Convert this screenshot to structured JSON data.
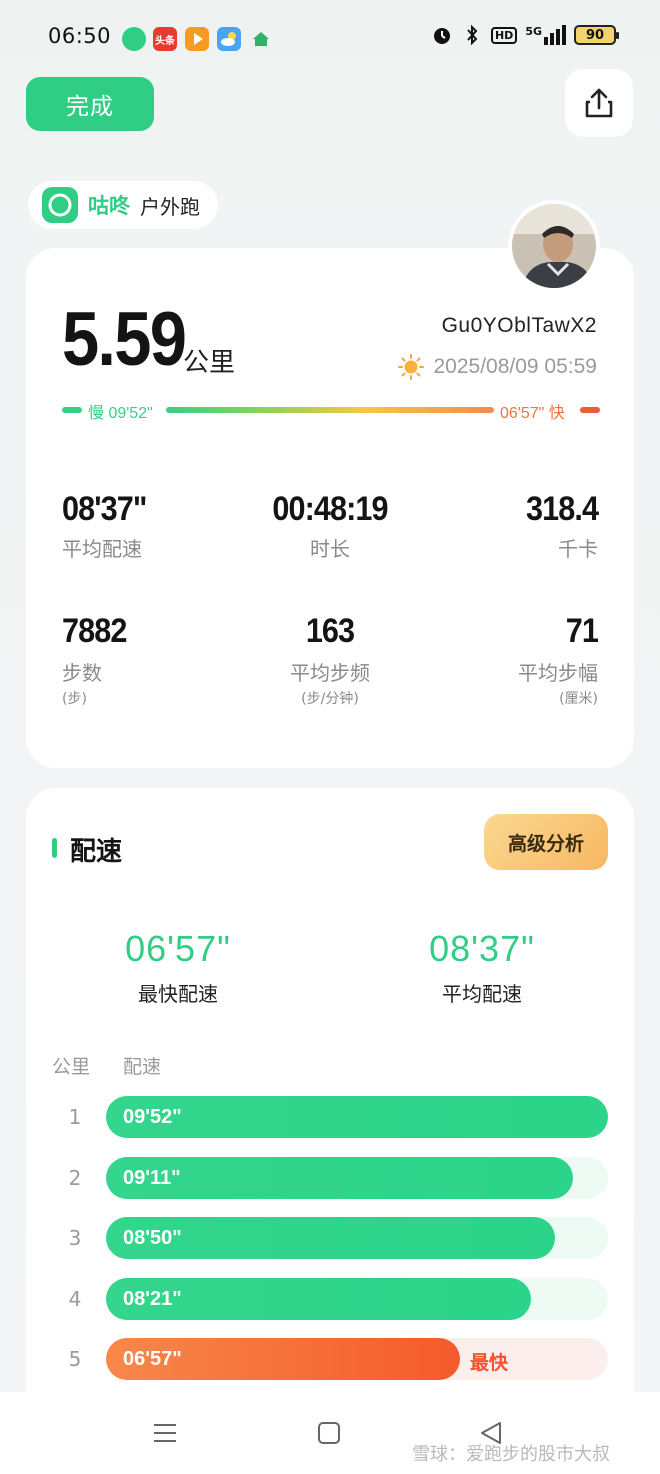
{
  "status_bar": {
    "time": "06:50",
    "app_icons": [
      "dongdong-icon",
      "toutiao-icon",
      "video-icon",
      "weather-icon",
      "anjuke-icon"
    ],
    "right_icons": [
      "alarm-icon",
      "bluetooth-icon",
      "hd-icon",
      "signal-5g-icon"
    ],
    "hd": "HD",
    "net": "5G",
    "battery": "90"
  },
  "header": {
    "done_label": "完成"
  },
  "brand": {
    "name": "咕咚",
    "activity": "户外跑"
  },
  "summary": {
    "distance": "5.59",
    "distance_unit": "公里",
    "username": "Gu0YOblTawX2",
    "datetime": "2025/08/09 05:59",
    "pace_slow": "慢 09'52\"",
    "pace_fast": "06'57\" 快",
    "stats": [
      {
        "value": "08'37\"",
        "label": "平均配速"
      },
      {
        "value": "00:48:19",
        "label": "时长"
      },
      {
        "value": "318.4",
        "label": "千卡"
      },
      {
        "value": "7882",
        "label": "步数",
        "sub": "(步)"
      },
      {
        "value": "163",
        "label": "平均步频",
        "sub": "(步/分钟)"
      },
      {
        "value": "71",
        "label": "平均步幅",
        "sub": "(厘米)"
      }
    ]
  },
  "pace_section": {
    "title": "配速",
    "advanced_label": "高级分析",
    "fastest_value": "06'57\"",
    "fastest_label": "最快配速",
    "average_value": "08'37\"",
    "average_label": "平均配速",
    "col_km": "公里",
    "col_pace": "配速",
    "fastest_tag": "最快",
    "splits": [
      {
        "km": "1",
        "pace": "09'52\"",
        "fill_pct": 100,
        "fastest": false
      },
      {
        "km": "2",
        "pace": "09'11\"",
        "fill_pct": 93,
        "fastest": false
      },
      {
        "km": "3",
        "pace": "08'50\"",
        "fill_pct": 89.5,
        "fastest": false
      },
      {
        "km": "4",
        "pace": "08'21\"",
        "fill_pct": 84.6,
        "fastest": false
      },
      {
        "km": "5",
        "pace": "06'57\"",
        "fill_pct": 70.5,
        "fastest": true
      }
    ]
  },
  "nav": {
    "icons": [
      "menu-icon",
      "home-icon",
      "back-icon"
    ]
  },
  "watermark": "雪球：爱跑步的股市大叔",
  "colors": {
    "accent": "#2fce84",
    "fast": "#f5532c",
    "gold": "#f6b862"
  }
}
